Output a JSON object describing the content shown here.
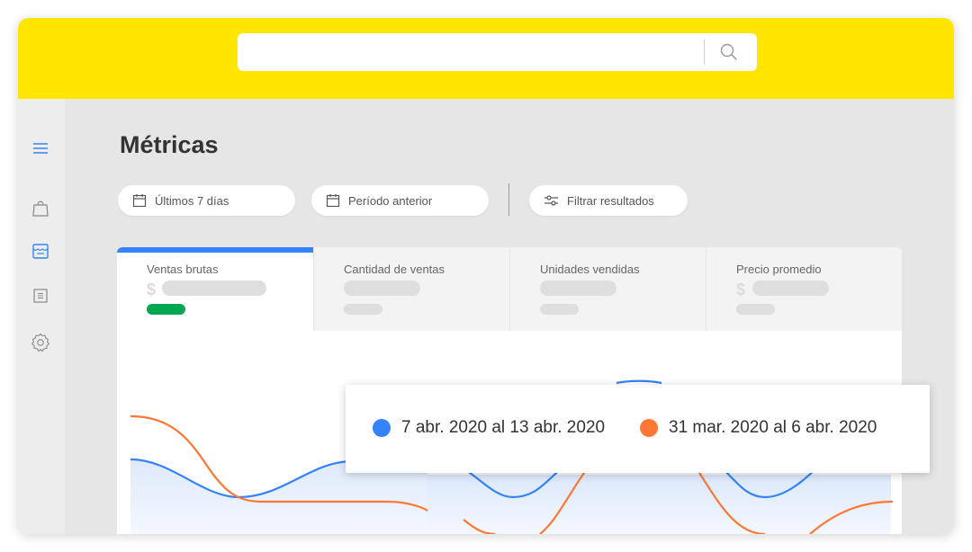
{
  "search": {
    "placeholder": "",
    "value": ""
  },
  "sidebar": {
    "items": [
      {
        "icon": "menu-icon"
      },
      {
        "icon": "shopping-bag-icon"
      },
      {
        "icon": "store-icon",
        "active": true
      },
      {
        "icon": "list-icon"
      },
      {
        "icon": "gear-icon"
      }
    ]
  },
  "page": {
    "title": "Métricas"
  },
  "filters": {
    "period": "Últimos 7 días",
    "compare": "Período anterior",
    "filter": "Filtrar resultados"
  },
  "metrics": {
    "tabs": [
      {
        "label": "Ventas brutas",
        "active": true
      },
      {
        "label": "Cantidad de ventas"
      },
      {
        "label": "Unidades vendidas"
      },
      {
        "label": "Precio promedio"
      }
    ]
  },
  "legend": {
    "current": "7 abr. 2020 al 13 abr. 2020",
    "previous": "31 mar. 2020 al 6 abr. 2020"
  },
  "colors": {
    "brand_yellow": "#ffe600",
    "accent_blue": "#3483fa",
    "series_current": "#3483fa",
    "series_previous": "#ff7733",
    "positive_green": "#00a650"
  }
}
